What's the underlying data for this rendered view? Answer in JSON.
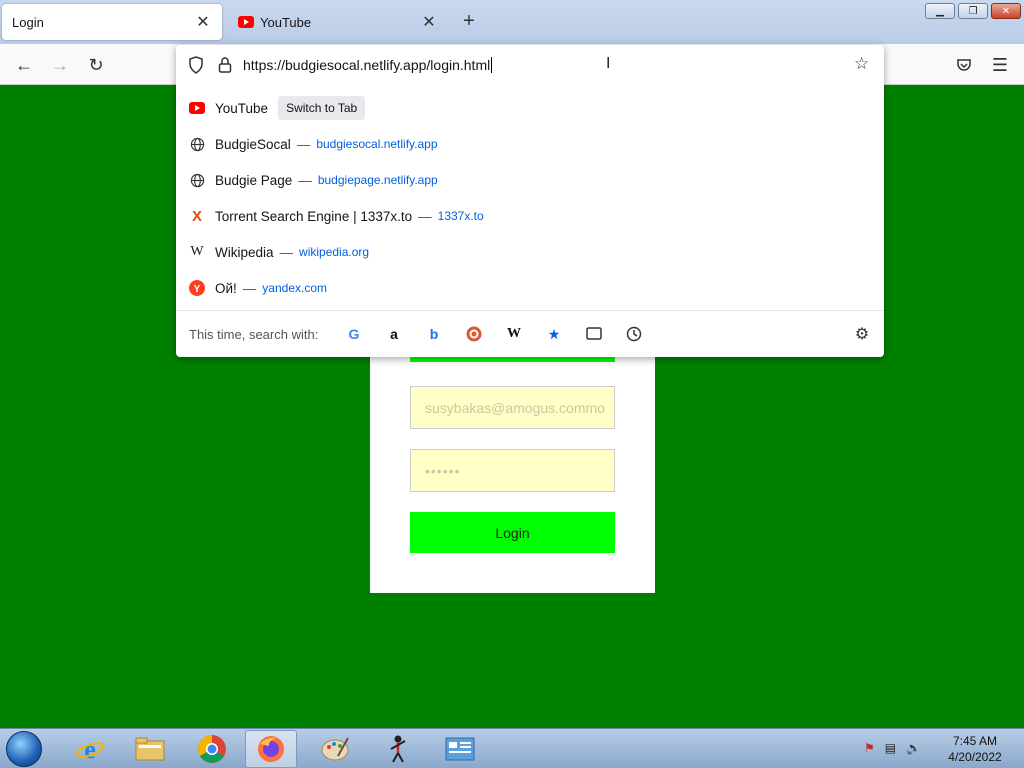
{
  "tabs": [
    {
      "label": "Login",
      "active": true
    },
    {
      "label": "YouTube",
      "active": false
    }
  ],
  "address_bar": {
    "url": "https://budgiesocal.netlify.app/login.html"
  },
  "suggestions": [
    {
      "title": "YouTube",
      "icon": "youtube-icon",
      "action": "Switch to Tab",
      "url": ""
    },
    {
      "title": "BudgieSocal",
      "icon": "globe-icon",
      "dash": "—",
      "url": "budgiesocal.netlify.app"
    },
    {
      "title": "Budgie Page",
      "icon": "globe-icon",
      "dash": "—",
      "url": "budgiepage.netlify.app"
    },
    {
      "title": "Torrent Search Engine | 1337x.to",
      "icon": "1337x-icon",
      "dash": "—",
      "url": "1337x.to"
    },
    {
      "title": "Wikipedia",
      "icon": "wikipedia-icon",
      "dash": "—",
      "url": "wikipedia.org"
    },
    {
      "title": "Ой!",
      "icon": "yandex-icon",
      "dash": "—",
      "url": "yandex.com"
    }
  ],
  "search_with": {
    "label": "This time, search with:",
    "engines": [
      "google",
      "amazon",
      "bing",
      "duckduckgo",
      "wikipedia",
      "bookmarks",
      "tabs",
      "history"
    ]
  },
  "login_form": {
    "email_placeholder": "susybakas@amogus.commo",
    "password_mask": "••••••",
    "login_label": "Login"
  },
  "taskbar": {
    "time": "7:45 AM",
    "date": "4/20/2022"
  },
  "colors": {
    "page_background": "#008000",
    "accent_green": "#00ff00",
    "field_background": "#ffffc6",
    "link_blue": "#0060df"
  }
}
